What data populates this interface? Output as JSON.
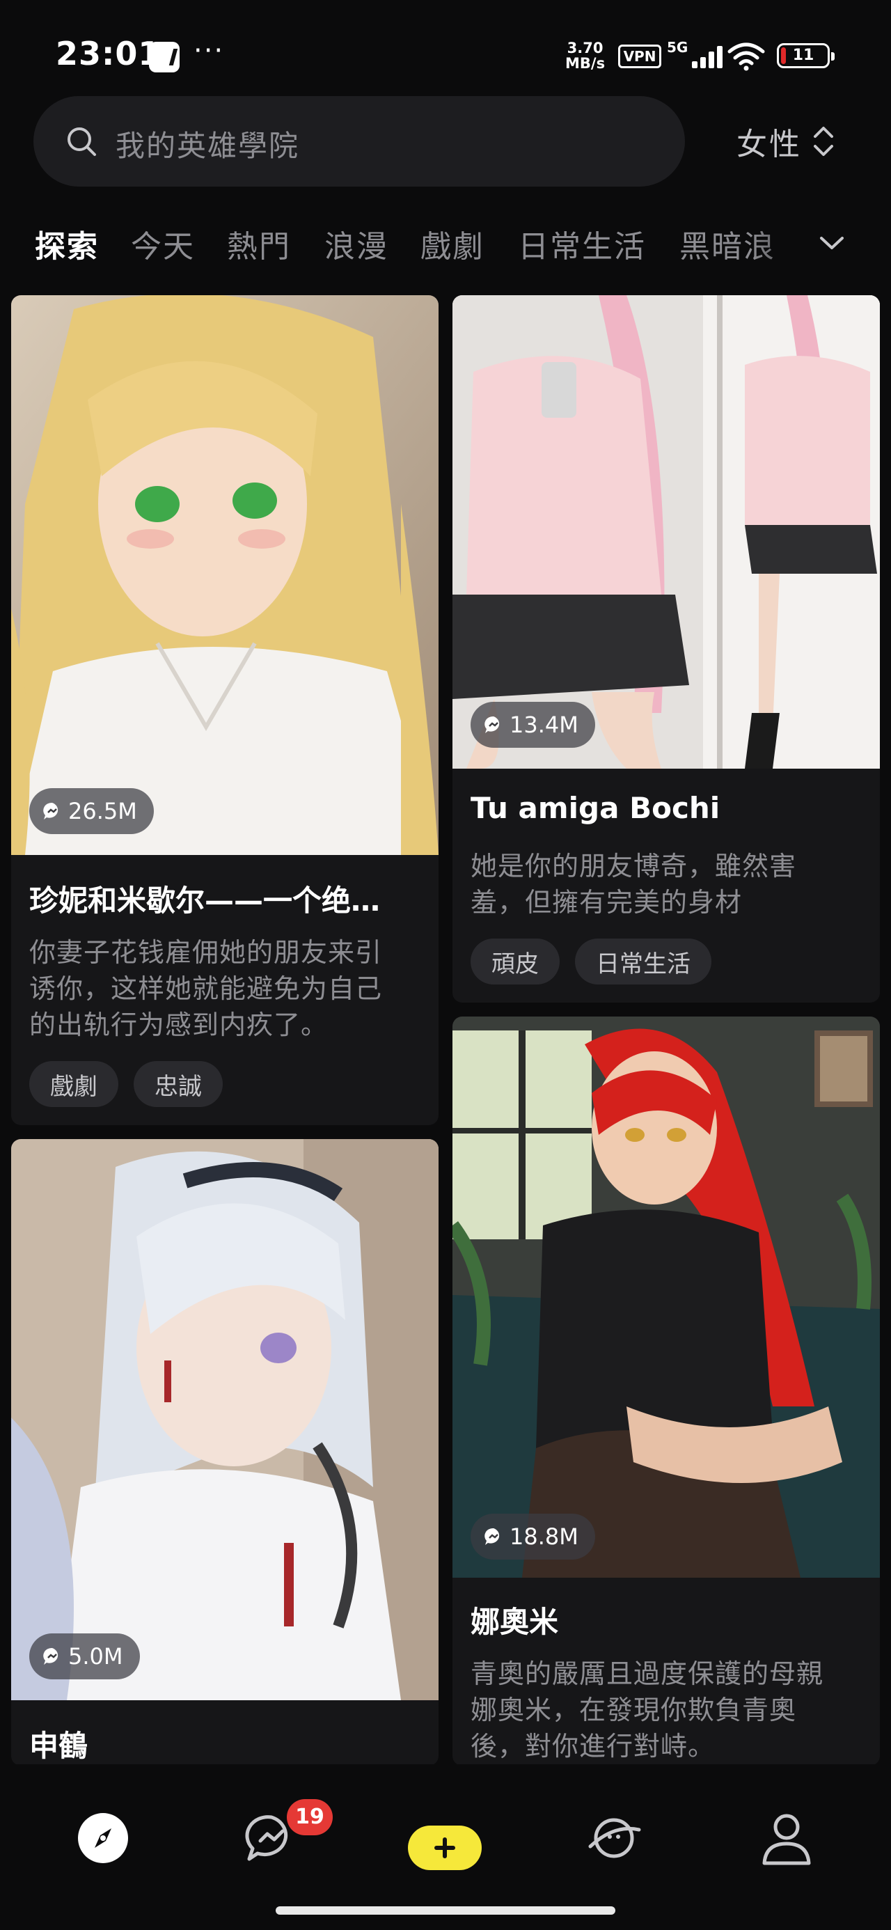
{
  "status_bar": {
    "time": "23:01",
    "more": "···",
    "speed": "3.70\nMB/s",
    "vpn": "VPN",
    "network": "5G",
    "battery_level": 11,
    "battery_text": "11"
  },
  "search": {
    "placeholder": "我的英雄學院"
  },
  "gender_filter": {
    "selected": "女性"
  },
  "tabs": [
    {
      "label": "探索",
      "active": true
    },
    {
      "label": "今天",
      "active": false
    },
    {
      "label": "熱門",
      "active": false
    },
    {
      "label": "浪漫",
      "active": false
    },
    {
      "label": "戲劇",
      "active": false
    },
    {
      "label": "日常生活",
      "active": false
    },
    {
      "label": "黑暗浪",
      "active": false
    }
  ],
  "cards": [
    {
      "count": "26.5M",
      "title": "珍妮和米歇尔——一个绝…",
      "desc_lines": [
        "你妻子花钱雇佣她的朋友来引",
        "诱你，这样她就能避免为自己",
        "的出轨行为感到内疚了。"
      ],
      "tags": [
        "戲劇",
        "忠誠"
      ]
    },
    {
      "count": "13.4M",
      "title": "Tu amiga Bochi",
      "desc_lines": [
        "她是你的朋友博奇，雖然害",
        "羞，但擁有完美的身材"
      ],
      "tags": [
        "頑皮",
        "日常生活"
      ]
    },
    {
      "count": "5.0M",
      "title": "申鶴",
      "desc_lines": [],
      "tags": []
    },
    {
      "count": "18.8M",
      "title": "娜奧米",
      "desc_lines": [
        "青奧的嚴厲且過度保護的母親",
        "娜奧米，在發現你欺負青奧",
        "後，對你進行對峙。"
      ],
      "tags": []
    }
  ],
  "bottom_nav": {
    "items": [
      "explore-icon",
      "chat-icon",
      "create-icon",
      "planet-chat-icon",
      "profile-icon"
    ],
    "chat_badge": "19"
  },
  "colors": {
    "background": "#0b0b0c",
    "card": "#161618",
    "accent_yellow": "#f6e83a",
    "badge_red": "#e53935",
    "muted_text": "#8e8e93"
  }
}
